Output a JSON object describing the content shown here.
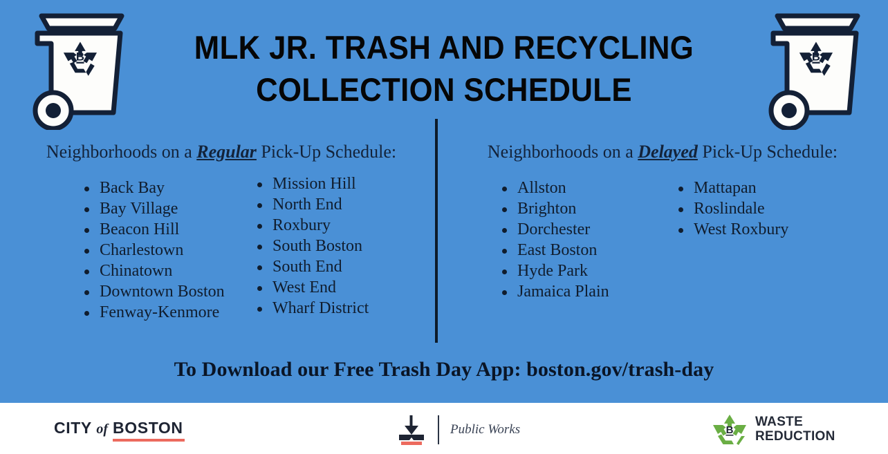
{
  "colors": {
    "background_blue": "#4a90d6",
    "ink_navy": "#101d2e",
    "footer_white": "#ffffff",
    "accent_red": "#ec6a5e",
    "recycle_green": "#6aae44",
    "public_works_navy": "#2b3445"
  },
  "title": {
    "line1": "MLK JR. TRASH AND RECYCLING",
    "line2": "COLLECTION SCHEDULE"
  },
  "decor": {
    "bin_left_name": "trash-bin-illustration-left",
    "bin_right_name": "trash-bin-illustration-right",
    "bin_recycle_letter": "B"
  },
  "regular": {
    "heading_before": "Neighborhoods on a ",
    "heading_emphasis": "Regular",
    "heading_after": " Pick-Up Schedule:",
    "column_a": [
      "Back Bay",
      "Bay Village",
      "Beacon Hill",
      "Charlestown",
      "Chinatown",
      "Downtown Boston",
      "Fenway-Kenmore"
    ],
    "column_b": [
      "Mission Hill",
      "North End",
      "Roxbury",
      "South Boston",
      "South End",
      "West End",
      "Wharf District"
    ]
  },
  "delayed": {
    "heading_before": "Neighborhoods on a ",
    "heading_emphasis": "Delayed",
    "heading_after": " Pick-Up Schedule:",
    "column_a": [
      "Allston",
      "Brighton",
      "Dorchester",
      "East Boston",
      "Hyde Park",
      "Jamaica Plain"
    ],
    "column_b": [
      "Mattapan",
      "Roslindale",
      "West Roxbury"
    ]
  },
  "cta": {
    "text": "To Download our Free Trash Day App: boston.gov/trash-day"
  },
  "footer": {
    "city_logo": {
      "city": "CITY",
      "of": "of",
      "boston": "BOSTON"
    },
    "public_works": {
      "mark_name": "public-works-mark-icon",
      "label": "Public Works"
    },
    "waste_reduction": {
      "mark_name": "recycling-symbol-icon",
      "mark_letter": "B",
      "line1": "WASTE",
      "line2": "REDUCTION"
    }
  }
}
